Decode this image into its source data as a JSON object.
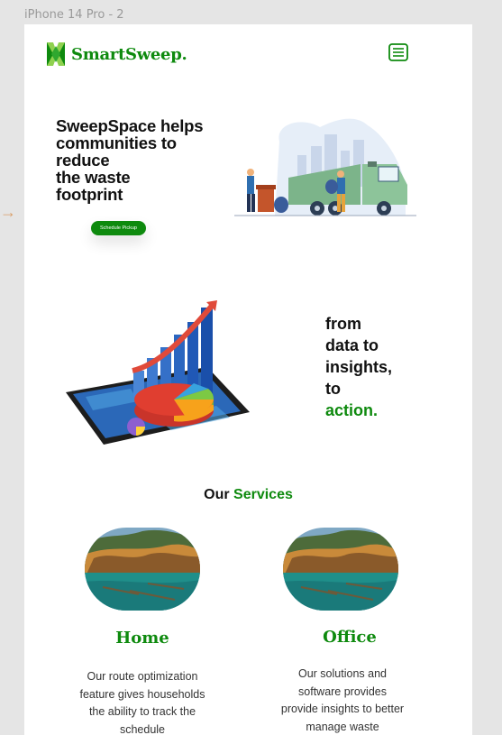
{
  "frame_label": "iPhone 14 Pro - 2",
  "brand": {
    "name": "SmartSweep.",
    "accent_color": "#0e8a0e"
  },
  "hero": {
    "title_lines": [
      "SweepSpace helps",
      "communities to",
      "reduce",
      "the waste",
      "footprint"
    ],
    "cta_label": "Schedule Pickup"
  },
  "tagline": {
    "lines": [
      "from",
      "data to",
      "insights,",
      "to"
    ],
    "accent": "action."
  },
  "services": {
    "title_prefix": "Our",
    "title_accent": "Services",
    "items": [
      {
        "name": "Home",
        "description": "Our route optimization feature gives households the ability to track the schedule"
      },
      {
        "name": "Office",
        "description": "Our solutions and software provides provide insights to better manage waste"
      }
    ]
  },
  "icons": {
    "menu": "menu-list-icon",
    "logo": "leaf-logo-icon",
    "side_arrow": "arrow-right-icon"
  }
}
